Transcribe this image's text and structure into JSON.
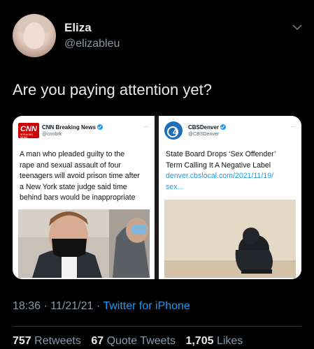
{
  "author": {
    "name": "Eliza",
    "handle": "@elizableu"
  },
  "tweet_text": "Are you paying attention yet?",
  "cards": [
    {
      "source_name": "CNN Breaking News",
      "source_handle": "@cnnbrk",
      "logo_text": "CNN",
      "logo_subtext": "BREAKING NEWS",
      "lines": [
        "A man who pleaded guilty to the",
        "rape and sexual assault of four",
        "teenagers will avoid prison time after",
        "a New York state judge said time",
        "behind bars would be inappropriate"
      ]
    },
    {
      "source_name": "CBSDenver",
      "source_handle": "@CBSDenver",
      "logo_text": "4",
      "lines": [
        "State Board Drops ‘Sex Offender’",
        "Term Calling It A Negative Label"
      ],
      "link_lines": [
        "denver.cbslocal.com/2021/11/19/",
        "sex..."
      ]
    }
  ],
  "meta": {
    "time": "18:36",
    "date": "11/21/21",
    "separator": "·",
    "app": "Twitter for iPhone"
  },
  "stats": {
    "retweets": "757",
    "retweets_label": "Retweets",
    "quote_tweets": "67",
    "quote_tweets_label": "Quote Tweets",
    "likes": "1,705",
    "likes_label": "Likes"
  },
  "colors": {
    "background": "#000000",
    "text": "#e7e9ea",
    "secondary": "#8b98a5",
    "accent": "#1d9bf0",
    "cnn_red": "#cc0000",
    "cbs_blue": "#1d6fb8"
  }
}
